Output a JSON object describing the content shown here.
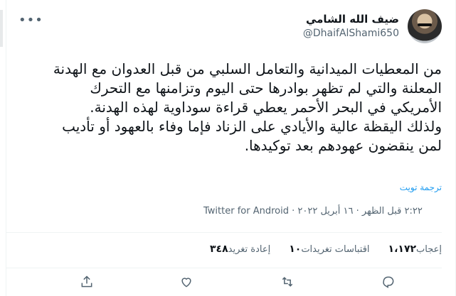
{
  "user": {
    "display_name": "ضيف الله الشامي",
    "handle": "@DhaifAlShami650"
  },
  "tweet": {
    "text": "من المعطيات الميدانية والتعامل السلبي من قبل العدوان مع الهدنة المعلنة والتي لم تظهر بوادرها حتى اليوم وتزامنها مع التحرك الأمريكي في البحر الأحمر يعطي قراءة سوداوية لهذه الهدنة.\nولذلك اليقظة عالية والأيادي على الزناد فإما وفاء بالعهود أو تأديب لمن ينقضون عهودهم بعد توكيدها.",
    "translate_label": "ترجمة تويت"
  },
  "meta": {
    "time_date": "٢:٢٢ قبل الظهر · ١٦ أبريل ٢٠٢٢ ·",
    "source": "Twitter for Android"
  },
  "stats": {
    "retweets_count": "٣٤٨",
    "retweets_label": "إعادة تغريد",
    "quotes_count": "١٠",
    "quotes_label": "اقتباسات تغريدات",
    "likes_count": "١،١٧٢",
    "likes_label": "إعجاب"
  },
  "icons": {
    "more": "more-icon",
    "reply": "reply-icon",
    "retweet": "retweet-icon",
    "like": "like-icon",
    "share": "share-icon"
  }
}
